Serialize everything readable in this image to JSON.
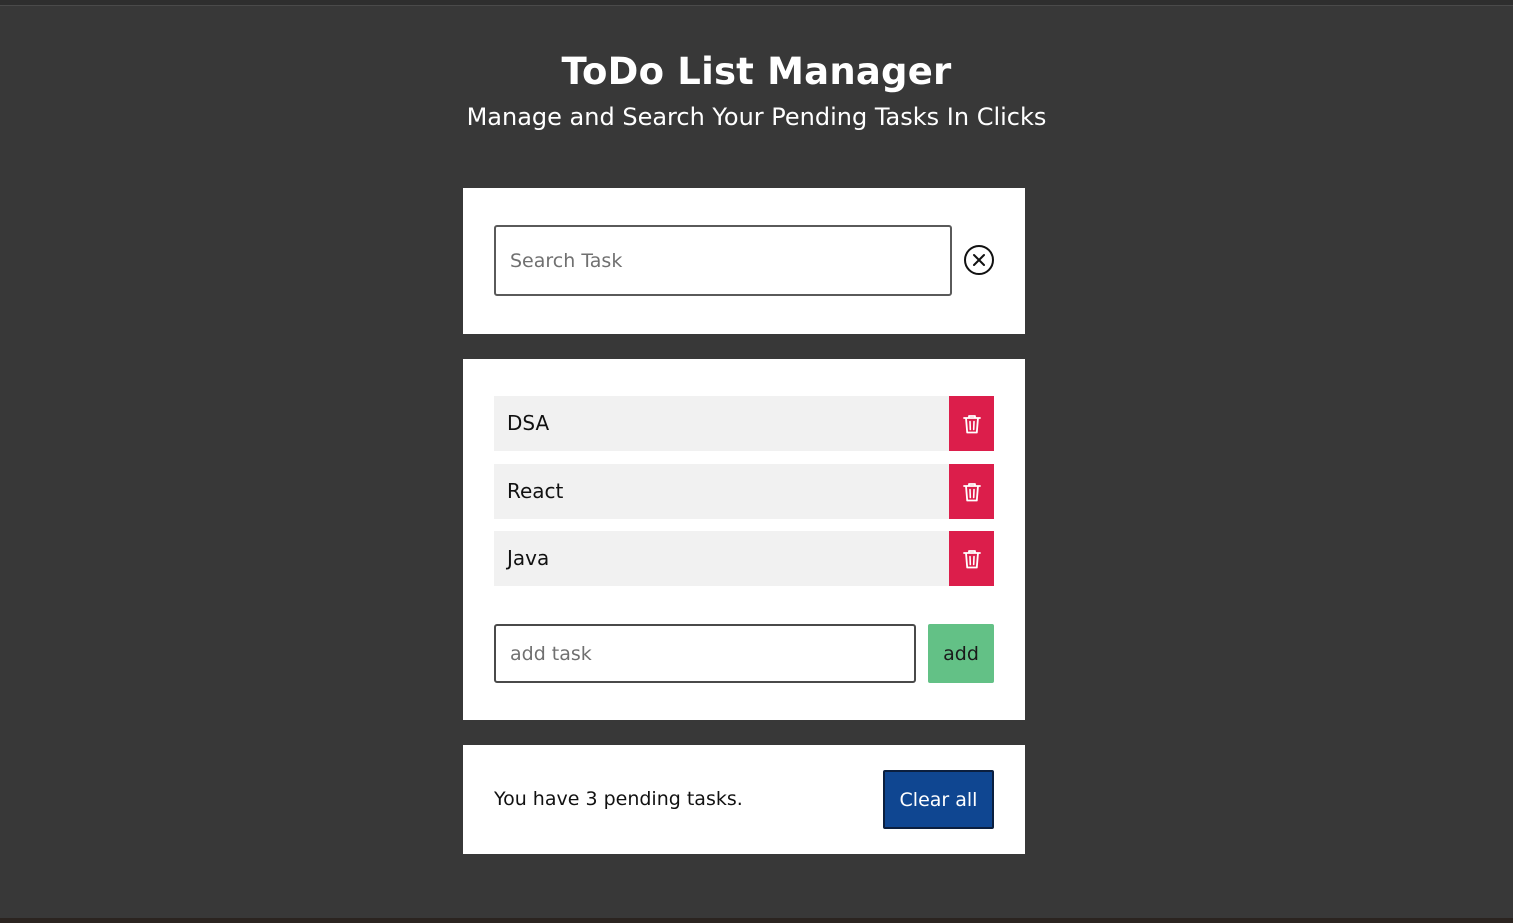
{
  "header": {
    "title": "ToDo List Manager",
    "subtitle": "Manage and Search Your Pending Tasks In Clicks"
  },
  "search": {
    "placeholder": "Search Task",
    "value": "",
    "clear_icon": "circle-x-icon"
  },
  "tasks": [
    {
      "label": "DSA",
      "delete_icon": "trash-icon"
    },
    {
      "label": "React",
      "delete_icon": "trash-icon"
    },
    {
      "label": "Java",
      "delete_icon": "trash-icon"
    }
  ],
  "add_task": {
    "placeholder": "add task",
    "value": "",
    "button_label": "add"
  },
  "footer": {
    "pending_text": "You have 3 pending tasks.",
    "clear_all_label": "Clear all"
  },
  "colors": {
    "background": "#383838",
    "delete": "#dc1e4b",
    "add": "#63c186",
    "clear_all": "#0f4691"
  }
}
